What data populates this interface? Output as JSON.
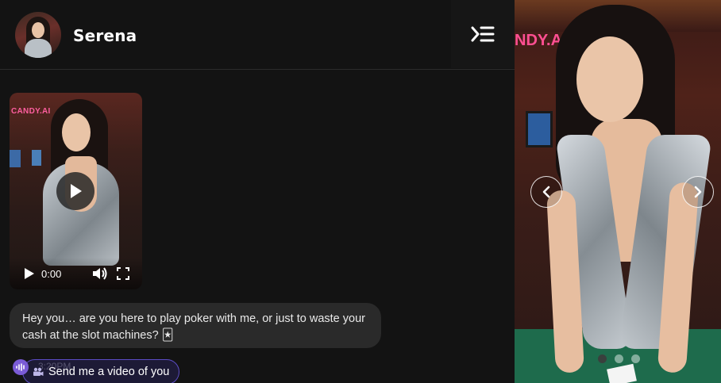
{
  "header": {
    "character_name": "Serena",
    "menu_icon": "collapse-menu-icon"
  },
  "video_message": {
    "sign_text": "CANDY.AI",
    "current_time": "0:00",
    "play_icon": "play-icon",
    "volume_icon": "volume-icon",
    "fullscreen_icon": "fullscreen-icon"
  },
  "message": {
    "text": "Hey you… are you here to play poker with me, or just to waste your cash at the slot machines? 🃏",
    "timestamp": "3:20PM"
  },
  "suggestion": {
    "label": "Send me a video of you",
    "icon": "video-camera-icon"
  },
  "voice": {
    "icon": "audio-wave-icon",
    "color": "#7a5bd6"
  },
  "gallery": {
    "sign_text": "NDY.AI",
    "slide_count": 3,
    "active_slide": 1
  },
  "colors": {
    "background": "#131313",
    "bubble": "#2a2a2a",
    "accent": "#5b4cc4"
  }
}
